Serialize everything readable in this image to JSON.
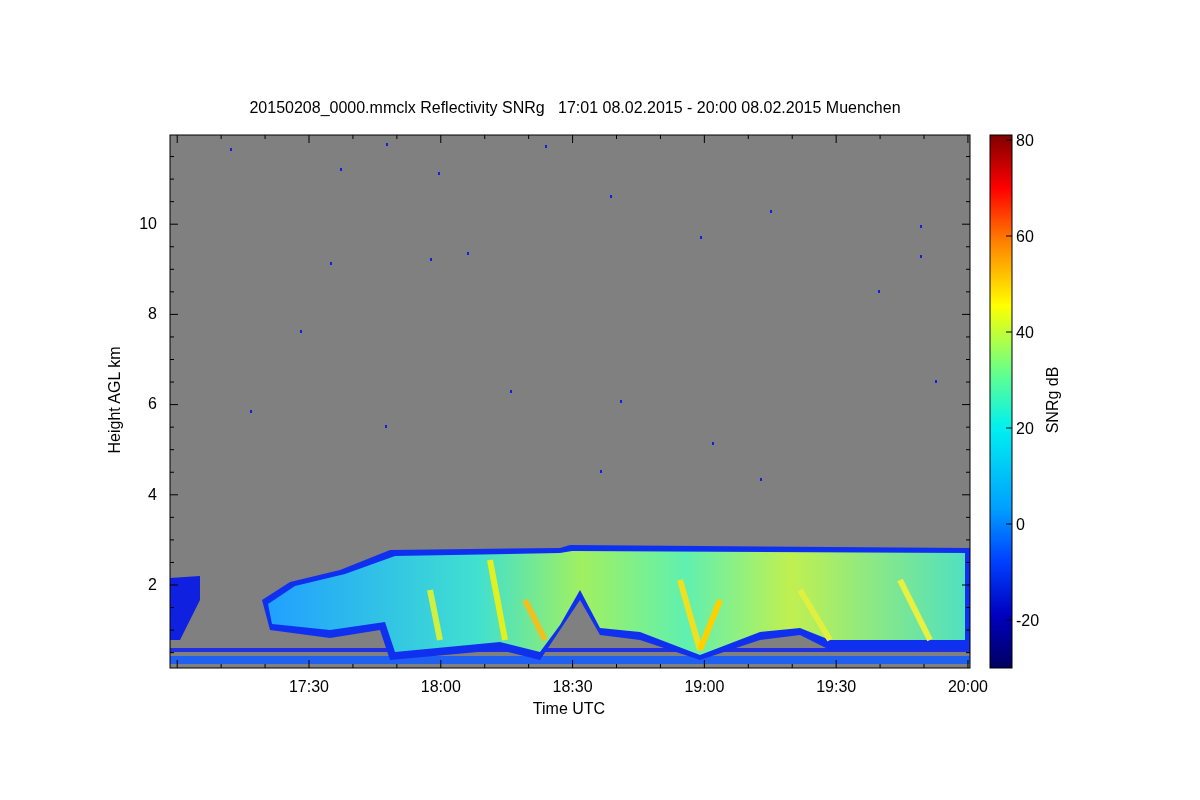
{
  "title": "20150208_0000.mmclx Reflectivity SNRg   17:01 08.02.2015 - 20:00 08.02.2015 Muenchen",
  "y_axis": {
    "label": "Height AGL km",
    "ticks": [
      "10",
      "8",
      "6",
      "4",
      "2"
    ]
  },
  "x_axis": {
    "label": "Time UTC",
    "ticks": [
      "17:30",
      "18:00",
      "18:30",
      "19:00",
      "19:30",
      "20:00"
    ]
  },
  "colorbar": {
    "label": "SNRg dB",
    "ticks": [
      "80",
      "60",
      "40",
      "20",
      "0",
      "-20"
    ]
  }
}
